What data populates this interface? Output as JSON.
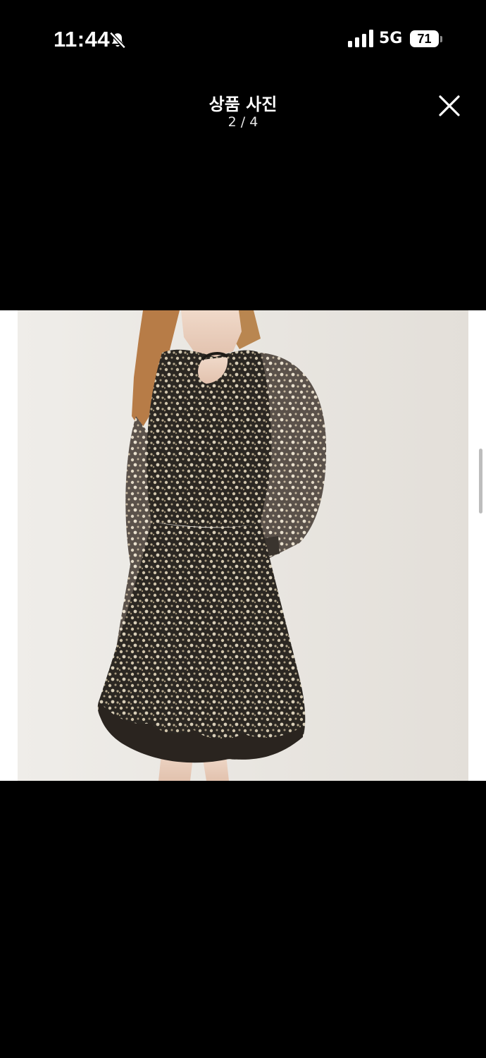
{
  "status_bar": {
    "time": "11:44",
    "mute_icon": "bell-slash-icon",
    "signal_icon": "cellular-signal-icon",
    "network": "5G",
    "battery": "71"
  },
  "viewer": {
    "title": "상품 사진",
    "counter": "2 / 4",
    "close_icon": "close-icon"
  },
  "photo": {
    "subject": "floral print mini dress with cutout neckline and sheer puff sleeves"
  },
  "colors": {
    "background": "#000000",
    "photo_backdrop": "#ebe8e3",
    "text": "#ffffff"
  }
}
